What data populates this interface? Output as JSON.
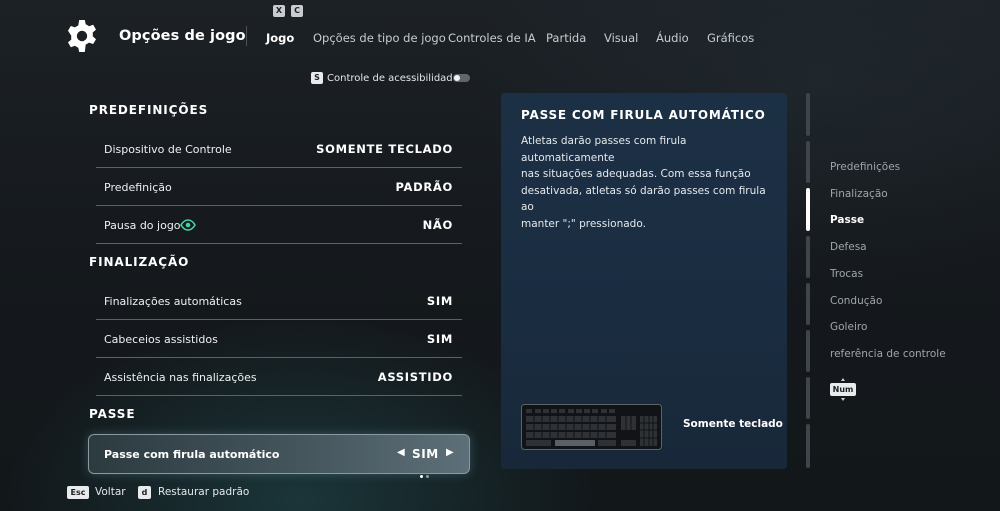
{
  "header": {
    "title": "Opções de jogo",
    "hint_keys": [
      "X",
      "C"
    ],
    "tabs": [
      {
        "label": "Jogo",
        "active": true
      },
      {
        "label": "Opções de tipo de jogo",
        "active": false
      },
      {
        "label": "Controles de IA",
        "active": false
      },
      {
        "label": "Partida",
        "active": false
      },
      {
        "label": "Visual",
        "active": false
      },
      {
        "label": "Áudio",
        "active": false
      },
      {
        "label": "Gráficos",
        "active": false
      }
    ]
  },
  "accessibility": {
    "key": "S",
    "label": "Controle de acessibilidade",
    "enabled": false
  },
  "sections": [
    {
      "title": "PREDEFINIÇÕES",
      "rows": [
        {
          "label": "Dispositivo de Controle",
          "value": "SOMENTE TECLADO"
        },
        {
          "label": "Predefinição",
          "value": "PADRÃO"
        },
        {
          "label": "Pausa do jogo",
          "value": "NÃO",
          "icon": "eye-icon"
        }
      ]
    },
    {
      "title": "FINALIZAÇÃO",
      "rows": [
        {
          "label": "Finalizações automáticas",
          "value": "SIM"
        },
        {
          "label": "Cabeceios assistidos",
          "value": "SIM"
        },
        {
          "label": "Assistência nas finalizações",
          "value": "ASSISTIDO"
        }
      ]
    },
    {
      "title": "PASSE",
      "rows": []
    }
  ],
  "selected_row": {
    "label": "Passe com firula automático",
    "value": "SIM",
    "left_arrow": "◀",
    "right_arrow": "▶",
    "option_count": 2,
    "option_index": 0
  },
  "description": {
    "title": "PASSE COM FIRULA AUTOMÁTICO",
    "lines": [
      "Atletas darão passes com firula automaticamente",
      "nas situações adequadas. Com essa função",
      "desativada, atletas só darão passes com firula ao",
      "manter \";\" pressionado."
    ],
    "device_label": "Somente teclado",
    "device_icon": "keyboard-icon"
  },
  "side_nav": {
    "items": [
      "Predefinições",
      "Finalização",
      "Passe",
      "Defesa",
      "Trocas",
      "Condução",
      "Goleiro",
      "referência de controle"
    ],
    "active_index": 2,
    "badge": "Num"
  },
  "footer": [
    {
      "key": "Esc",
      "label": "Voltar"
    },
    {
      "key": "d",
      "label": "Restaurar padrão"
    }
  ],
  "colors": {
    "accent_green": "#48d0a0",
    "panel": "#1c3045"
  }
}
